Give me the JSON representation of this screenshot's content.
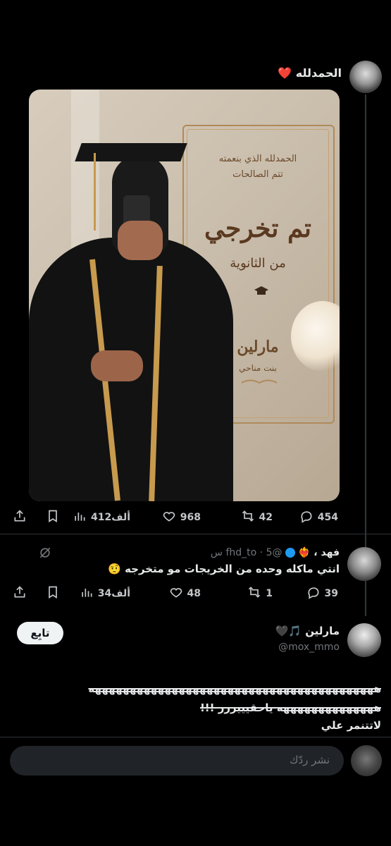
{
  "top_tweet": {
    "text": "الحمدلله",
    "heart": "❤️",
    "card": {
      "line1": "الحمدلله الذي بنعمته",
      "line2": "تتم الصالحات",
      "title": "تم تخرجي",
      "subtitle": "من الثانوية",
      "name": "مارلين",
      "family": "بنت مناحي"
    },
    "actions": {
      "replies": "454",
      "retweets": "42",
      "likes": "968",
      "views": "412ألف"
    }
  },
  "reply1": {
    "display_name": "فهد ،",
    "emoji": "❤️‍🔥",
    "handle": "@fhd_to",
    "time": "5 س",
    "dot": "·",
    "text": "انتي ماكله وحده من الخريجات مو متخرجه 🤨",
    "actions": {
      "replies": "39",
      "retweets": "1",
      "likes": "48",
      "views": "34ألف"
    }
  },
  "reply2": {
    "display_name": "مارلين",
    "emoji": "🎵🖤",
    "handle": "@mox_mmo",
    "follow_label": "تابِع",
    "line1": "هههههههههههههههههههههههههههههههههههههههههه",
    "line2": "ههههههههههههههه ياحقيييررر !!!",
    "line3": "لاتتنمر علي"
  },
  "composer": {
    "placeholder": "نشر ردّك"
  },
  "colors": {
    "background": "#000000",
    "verified": "#1d9bf0",
    "heart": "#f91880"
  }
}
